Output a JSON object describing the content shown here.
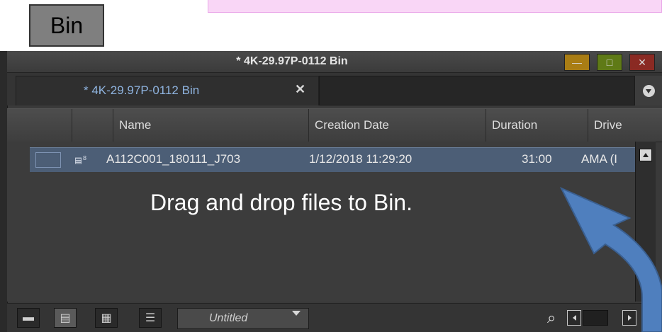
{
  "annotation": {
    "label": "Bin",
    "instruction": "Drag and drop files to Bin."
  },
  "window": {
    "title": "* 4K-29.97P-0112 Bin",
    "buttons": {
      "minimize": "—",
      "maximize": "□",
      "close": "✕"
    }
  },
  "tab": {
    "title": "* 4K-29.97P-0112 Bin",
    "close": "✕"
  },
  "columns": [
    "Name",
    "Creation Date",
    "Duration",
    "Drive"
  ],
  "rows": [
    {
      "name": "A112C001_180111_J703",
      "creation_date": "1/12/2018 11:29:20",
      "duration": "31:00",
      "drive": "AMA (I"
    }
  ],
  "bottom": {
    "view_name": "Untitled"
  },
  "icons": {
    "row_clip": "clip-icon",
    "search": "search-icon",
    "tab_menu": "fast-menu-icon"
  },
  "colors": {
    "selected_row": "#4c5e76",
    "arrow": "#4f7fbe",
    "annotation_strip": "#f9d6f6",
    "tab_title": "#8fb4e0"
  }
}
